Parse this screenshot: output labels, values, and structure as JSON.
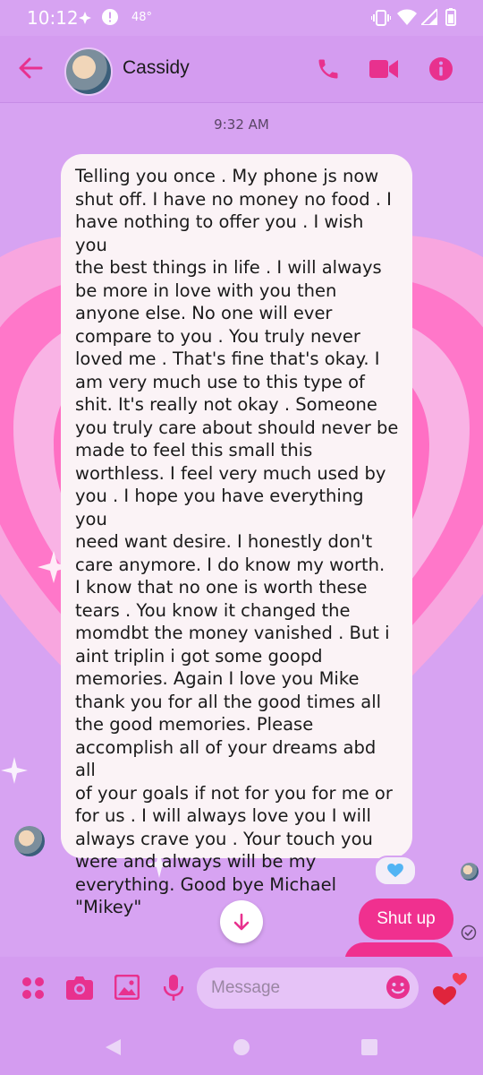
{
  "status_bar": {
    "time": "10:12",
    "temperature": "48°",
    "icons": [
      "sparkle-icon",
      "alert-icon",
      "vibrate-icon",
      "wifi-icon",
      "signal-icon",
      "battery-icon"
    ]
  },
  "header": {
    "contact_name": "Cassidy",
    "icons": [
      "back-arrow-icon",
      "phone-icon",
      "video-icon",
      "info-icon"
    ],
    "accent_color": "#e8318e"
  },
  "thread": {
    "timestamp": "9:32 AM",
    "incoming_message": "Telling you once . My phone js now\nshut off. I have no money no food . I\nhave nothing to offer you . I wish you\nthe best things in life . I will always\nbe more in love with you then\nanyone else.  No one will ever\ncompare to you . You truly never\nloved me . That's fine that's okay.  I\nam very much use to this type of\nshit. It's really not okay . Someone\nyou truly care about should never be\nmade to feel this small this\nworthless.  I feel very much used by\nyou . I hope you have everything you\nneed want desire.  I honestly don't\ncare anymore.  I do know my worth.\nI know that no one is worth these\ntears .  You know it changed the\nmomdbt the money vanished . But i\naint triplin i got  some goopd\nmemories.  Again I love you Mike\nthank you for all the good times all\nthe good memories.  Please\naccomplish all of your dreams abd all\nof your goals if not for you for me or\nfor us . I will always love you I will\nalways crave you . Your touch you\nwere and always will be my\neverything.  Good bye Michael\n\"Mikey\"",
    "reaction": "blue-heart-icon",
    "outgoing_message": "Shut up",
    "outgoing_color": "#f0308f",
    "bubble_in_color": "#fbf3f6"
  },
  "composer": {
    "placeholder": "Message",
    "icons": [
      "apps-icon",
      "camera-icon",
      "gallery-icon",
      "mic-icon",
      "emoji-icon",
      "hearts-icon"
    ]
  },
  "background": {
    "base_color": "#d7a3f2",
    "theme": "pink-hearts"
  }
}
